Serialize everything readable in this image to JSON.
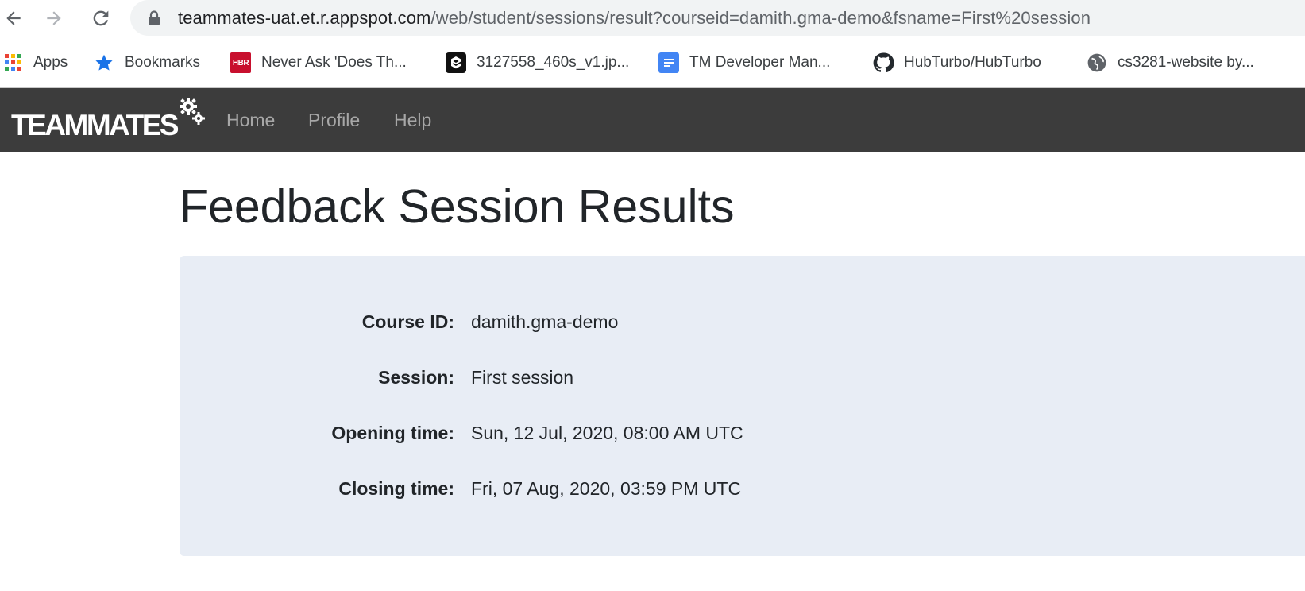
{
  "browser": {
    "url_host": "teammates-uat.et.r.appspot.com",
    "url_path": "/web/student/sessions/result?courseid=damith.gma-demo&fsname=First%20session",
    "bookmarks": [
      {
        "label": "Apps",
        "icon": "apps-grid-icon"
      },
      {
        "label": "Bookmarks",
        "icon": "star-icon"
      },
      {
        "label": "Never Ask 'Does Th...",
        "icon": "hbr-icon",
        "icon_text": "HBR"
      },
      {
        "label": "3127558_460s_v1.jp...",
        "icon": "9gag-icon"
      },
      {
        "label": "TM Developer Man...",
        "icon": "google-docs-icon"
      },
      {
        "label": "HubTurbo/HubTurbo",
        "icon": "github-icon"
      },
      {
        "label": "cs3281-website by...",
        "icon": "globe-icon"
      }
    ]
  },
  "navbar": {
    "brand": "TEAMMATES",
    "links": [
      "Home",
      "Profile",
      "Help"
    ]
  },
  "page": {
    "title": "Feedback Session Results",
    "details": [
      {
        "label": "Course ID:",
        "value": "damith.gma-demo"
      },
      {
        "label": "Session:",
        "value": "First session"
      },
      {
        "label": "Opening time:",
        "value": "Sun, 12 Jul, 2020, 08:00 AM UTC"
      },
      {
        "label": "Closing time:",
        "value": "Fri, 07 Aug, 2020, 03:59 PM UTC"
      }
    ]
  },
  "colors": {
    "navbar_bg": "#3c3c3c",
    "panel_bg": "#e8edf5",
    "star": "#1a73e8",
    "hbr": "#c8102e",
    "docs": "#4285f4"
  }
}
